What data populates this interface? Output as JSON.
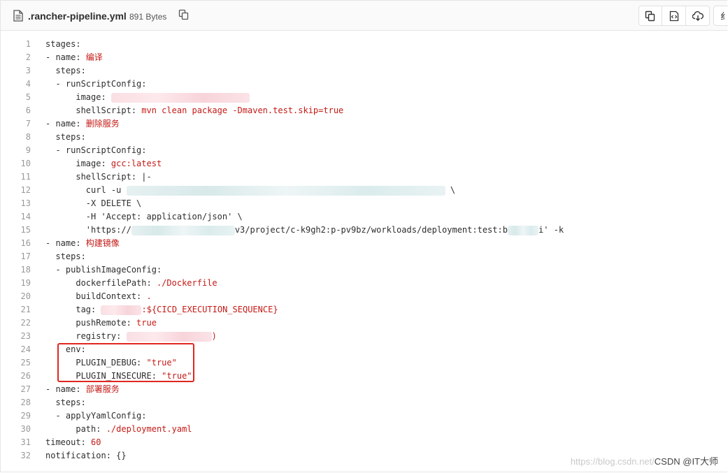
{
  "file": {
    "name": ".rancher-pipeline.yml",
    "size": "891 Bytes"
  },
  "toolbar": {
    "copy_icon": "copy-icon",
    "raw_icon": "raw-file-icon",
    "download_icon": "download-icon",
    "more_label": "纟"
  },
  "line_numbers": [
    "1",
    "2",
    "3",
    "4",
    "5",
    "6",
    "7",
    "8",
    "9",
    "10",
    "11",
    "12",
    "13",
    "14",
    "15",
    "16",
    "17",
    "18",
    "19",
    "20",
    "21",
    "22",
    "23",
    "24",
    "25",
    "26",
    "27",
    "28",
    "29",
    "30",
    "31",
    "32"
  ],
  "code": {
    "l1_key": "stages:",
    "l2_prefix": "- name: ",
    "l2_val": "编译",
    "l3_key": "  steps:",
    "l4_key": "  - runScriptConfig:",
    "l5_key": "      image: ",
    "l6_key": "      shellScript: ",
    "l6_val": "mvn clean package -Dmaven.test.skip=true",
    "l7_prefix": "- name: ",
    "l7_val": "删除服务",
    "l8_key": "  steps:",
    "l9_key": "  - runScriptConfig:",
    "l10_key": "      image: ",
    "l10_val": "gcc:latest",
    "l11_key": "      shellScript: |-",
    "l12_key": "        curl -u ",
    "l12_tail": " \\",
    "l13_key": "        -X DELETE \\",
    "l14_key": "        -H 'Accept: application/json' \\",
    "l15_a": "        'https://",
    "l15_b": "v3/project/c-k9gh2:p-pv9bz/workloads/deployment:test:b",
    "l15_c": "i' -k",
    "l16_prefix": "- name: ",
    "l16_val": "构建镜像",
    "l17_key": "  steps:",
    "l18_key": "  - publishImageConfig:",
    "l19_key": "      dockerfilePath: ",
    "l19_val": "./Dockerfile",
    "l20_key": "      buildContext: ",
    "l20_val": ".",
    "l21_key": "      tag: ",
    "l21_val": ":${CICD_EXECUTION_SEQUENCE}",
    "l22_key": "      pushRemote: ",
    "l22_val": "true",
    "l23_key": "      registry: ",
    "l23_val": ")",
    "l24_key": "    env:",
    "l25_key": "      PLUGIN_DEBUG: ",
    "l25_val": "\"true\"",
    "l26_key": "      PLUGIN_INSECURE: ",
    "l26_val": "\"true\"",
    "l27_prefix": "- name: ",
    "l27_val": "部署服务",
    "l28_key": "  steps:",
    "l29_key": "  - applyYamlConfig:",
    "l30_key": "      path: ",
    "l30_val": "./deployment.yaml",
    "l31_key": "timeout: ",
    "l31_val": "60",
    "l32_key": "notification: {}"
  },
  "watermark": {
    "url": "https://blog.csdn.net/",
    "brand": "CSDN @IT大师"
  },
  "colors": {
    "highlight_border": "#e0271f",
    "value_red": "#c41a16"
  }
}
